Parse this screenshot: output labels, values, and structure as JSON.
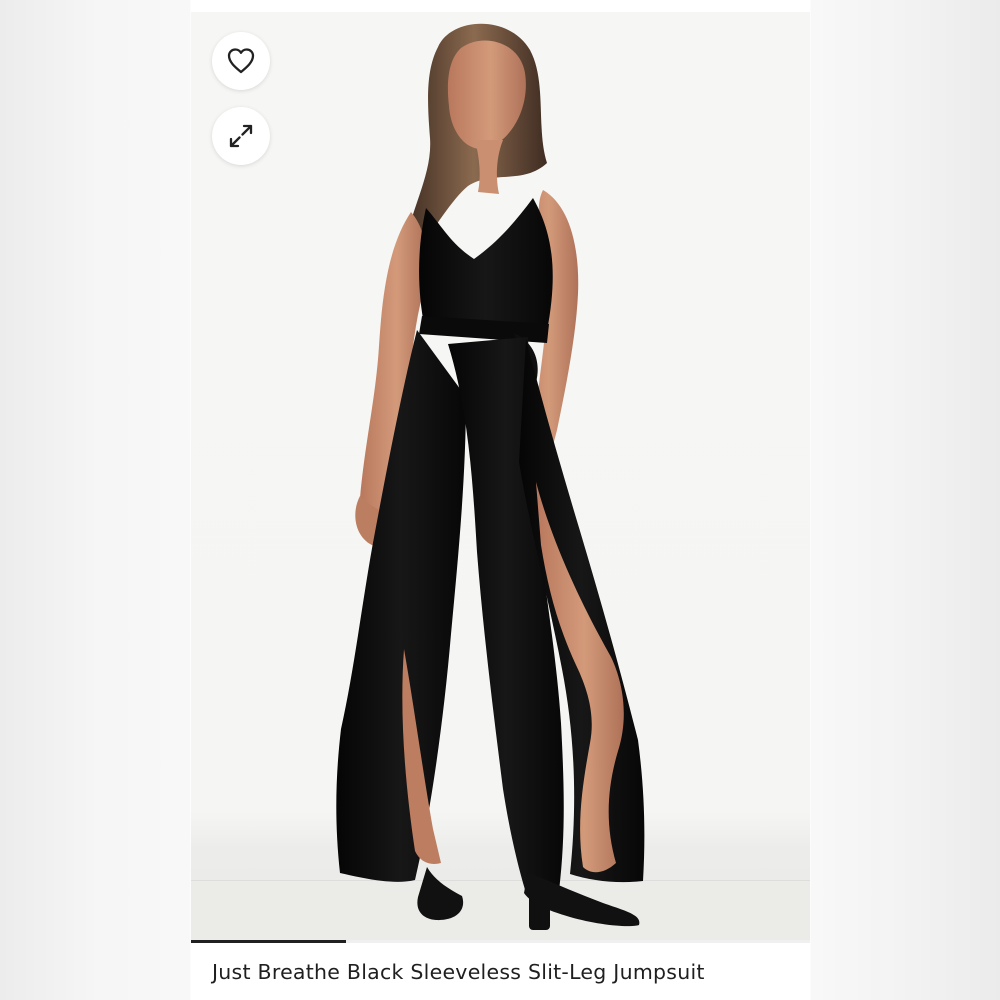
{
  "product": {
    "title": "Just Breathe Black Sleeveless Slit-Leg Jumpsuit",
    "image_alt": "Model wearing a black sleeveless jumpsuit with tie waist and side slits, paired with black strappy heels"
  },
  "controls": {
    "favorite_icon": "heart-icon",
    "expand_icon": "expand-arrows-icon"
  },
  "gallery": {
    "progress": 0.25
  },
  "colors": {
    "background": "#f5f5f3",
    "garment": "#111111",
    "skin": "#c58d6d",
    "text": "#1f1f1f",
    "progress": "#202020"
  }
}
